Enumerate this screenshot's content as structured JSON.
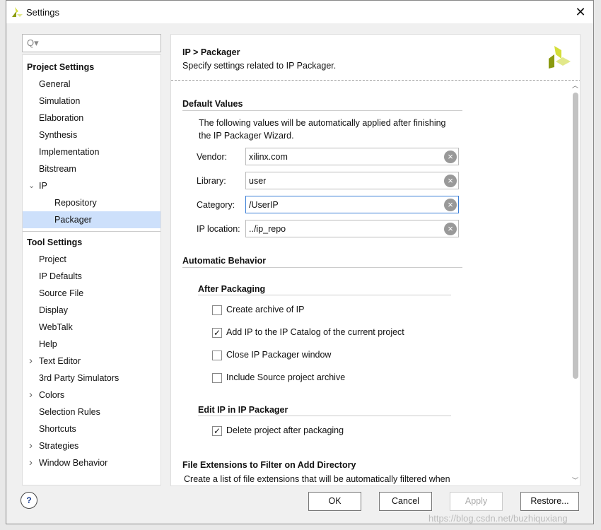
{
  "window": {
    "title": "Settings",
    "close": "✕"
  },
  "search": {
    "icon": "search-icon",
    "glyph": "Q▾"
  },
  "tree": {
    "project_header": "Project Settings",
    "project_items": [
      "General",
      "Simulation",
      "Elaboration",
      "Synthesis",
      "Implementation",
      "Bitstream"
    ],
    "ip": "IP",
    "ip_children": [
      "Repository",
      "Packager"
    ],
    "tool_header": "Tool Settings",
    "tool_items": [
      {
        "label": "Project",
        "exp": false
      },
      {
        "label": "IP Defaults",
        "exp": false
      },
      {
        "label": "Source File",
        "exp": false
      },
      {
        "label": "Display",
        "exp": false
      },
      {
        "label": "WebTalk",
        "exp": false
      },
      {
        "label": "Help",
        "exp": false
      },
      {
        "label": "Text Editor",
        "exp": true
      },
      {
        "label": "3rd Party Simulators",
        "exp": false
      },
      {
        "label": "Colors",
        "exp": true
      },
      {
        "label": "Selection Rules",
        "exp": false
      },
      {
        "label": "Shortcuts",
        "exp": false
      },
      {
        "label": "Strategies",
        "exp": true
      },
      {
        "label": "Window Behavior",
        "exp": true
      }
    ]
  },
  "main": {
    "title": "IP > Packager",
    "subtitle": "Specify settings related to IP Packager.",
    "default_values": "Default Values",
    "desc1": "The following values will be automatically applied after finishing",
    "desc2": "the IP Packager Wizard.",
    "fields": [
      {
        "label": "Vendor:",
        "value": "xilinx.com"
      },
      {
        "label": "Library:",
        "value": "user"
      },
      {
        "label": "Category:",
        "value": "/UserIP"
      },
      {
        "label": "IP location:",
        "value": "../ip_repo"
      }
    ],
    "automatic_behavior": "Automatic Behavior",
    "after_packaging": "After Packaging",
    "after_items": [
      {
        "label": "Create archive of IP",
        "checked": false
      },
      {
        "label": "Add IP to the IP Catalog of the current project",
        "checked": true
      },
      {
        "label": "Close IP Packager window",
        "checked": false
      },
      {
        "label": "Include Source project archive",
        "checked": false
      }
    ],
    "edit_ip": "Edit IP in IP Packager",
    "edit_items": [
      {
        "label": "Delete project after packaging",
        "checked": true
      }
    ],
    "file_ext": "File Extensions to Filter on Add Directory",
    "file_ext_desc": "Create a list of file extensions that will be automatically filtered when"
  },
  "buttons": {
    "help": "?",
    "ok": "OK",
    "cancel": "Cancel",
    "apply": "Apply",
    "restore": "Restore..."
  },
  "watermark": "https://blog.csdn.net/buzhiquxiang",
  "colors": {
    "selection": "#cde0fb",
    "focus": "#3c7fd6",
    "logo_dark": "#8a9a10",
    "logo_light": "#d4de3a"
  }
}
